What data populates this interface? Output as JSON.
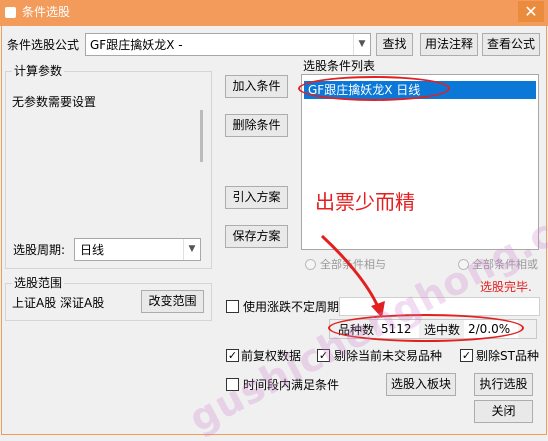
{
  "window": {
    "title": "条件选股",
    "close_glyph": "✕"
  },
  "formula_row": {
    "label": "条件选股公式",
    "value": "GF跟庄擒妖龙X  -",
    "buttons": {
      "find": "查找",
      "usage": "用法注释",
      "view": "查看公式"
    }
  },
  "params": {
    "legend": "计算参数",
    "message": "无参数需要设置"
  },
  "period": {
    "label": "选股周期:",
    "value": "日线"
  },
  "scope": {
    "legend": "选股范围",
    "value": "上证A股 深证A股",
    "change_button": "改变范围"
  },
  "mid_buttons": {
    "add": "加入条件",
    "delete": "删除条件",
    "import": "引入方案",
    "save": "保存方案"
  },
  "conditions": {
    "label": "选股条件列表",
    "items": [
      "GF跟庄擒妖龙X  日线"
    ]
  },
  "annotation": {
    "text": "出票少而精",
    "color": "#e32020"
  },
  "logic": {
    "and_label": "全部条件相与",
    "or_label": "全部条件相或"
  },
  "status": {
    "text": "选股完毕.",
    "color": "#e32020"
  },
  "options": {
    "variable_period": {
      "label": "使用涨跌不定周期",
      "checked": false
    }
  },
  "counts": {
    "total_label": "品种数",
    "total_value": "5112",
    "selected_label": "选中数",
    "selected_value": "2/0.0%"
  },
  "flags": {
    "pre_adjust": {
      "label": "前复权数据",
      "checked": true
    },
    "exclude_untraded": {
      "label": "剔除当前未交易品种",
      "checked": true
    },
    "exclude_st": {
      "label": "剔除ST品种",
      "checked": true
    },
    "time_range": {
      "label": "时间段内满足条件",
      "checked": false
    }
  },
  "actions": {
    "to_block": "选股入板块",
    "run": "执行选股",
    "close": "关闭"
  },
  "watermark": "gushichenghong.com"
}
